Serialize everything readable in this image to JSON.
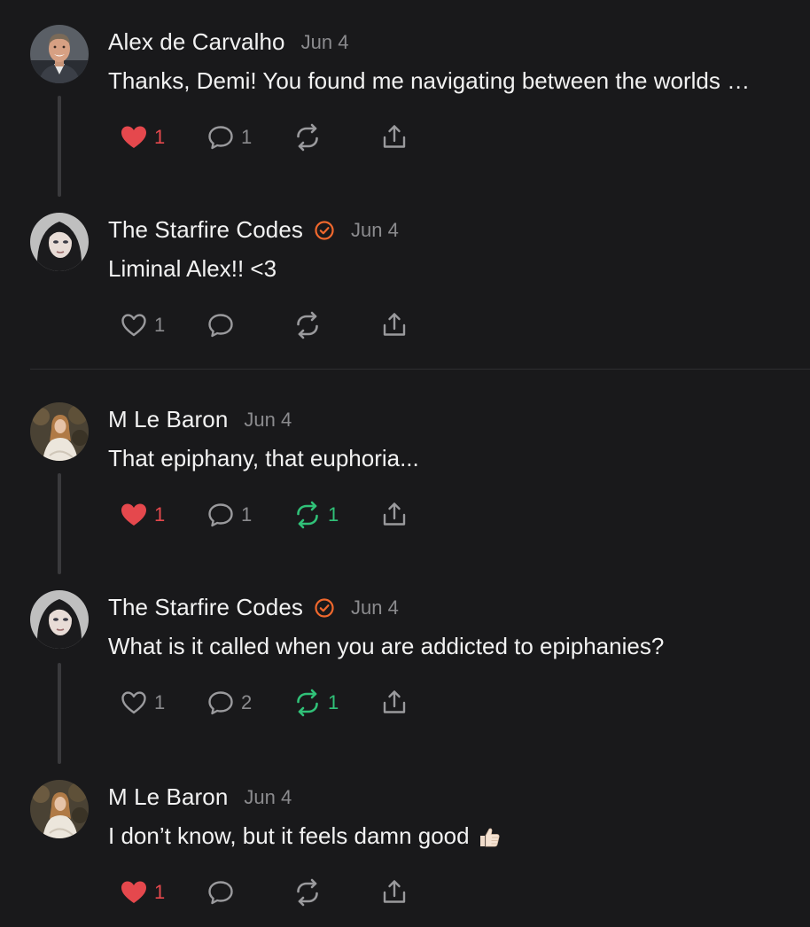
{
  "posts": [
    {
      "author": "Alex de Carvalho",
      "verified": false,
      "date": "Jun 4",
      "text": "Thanks, Demi! You found me navigating between the worlds …",
      "emoji": "",
      "likes": "1",
      "liked": true,
      "replies": "1",
      "reposts": "",
      "reposted": false,
      "avatar": "man-portrait"
    },
    {
      "author": "The Starfire Codes",
      "verified": true,
      "date": "Jun 4",
      "text": "Liminal Alex!! <3",
      "emoji": "",
      "likes": "1",
      "liked": false,
      "replies": "",
      "reposts": "",
      "reposted": false,
      "avatar": "dark-hair-portrait"
    },
    {
      "author": "M Le Baron",
      "verified": false,
      "date": "Jun 4",
      "text": "That epiphany, that euphoria...",
      "emoji": "",
      "likes": "1",
      "liked": true,
      "replies": "1",
      "reposts": "1",
      "reposted": true,
      "avatar": "woman-forest-portrait"
    },
    {
      "author": "The Starfire Codes",
      "verified": true,
      "date": "Jun 4",
      "text": "What is it called when you are addicted to epiphanies?",
      "emoji": "",
      "likes": "1",
      "liked": false,
      "replies": "2",
      "reposts": "1",
      "reposted": true,
      "avatar": "dark-hair-portrait"
    },
    {
      "author": "M Le Baron",
      "verified": false,
      "date": "Jun 4",
      "text": "I don’t know, but it feels damn good",
      "emoji": "thumbs-up-emoji",
      "likes": "1",
      "liked": true,
      "replies": "",
      "reposts": "",
      "reposted": false,
      "avatar": "woman-forest-portrait"
    }
  ],
  "colors": {
    "background": "#19191b",
    "like": "#e5484d",
    "repost": "#30c178",
    "verified": "#f0682d",
    "muted": "#8b8b8e"
  }
}
